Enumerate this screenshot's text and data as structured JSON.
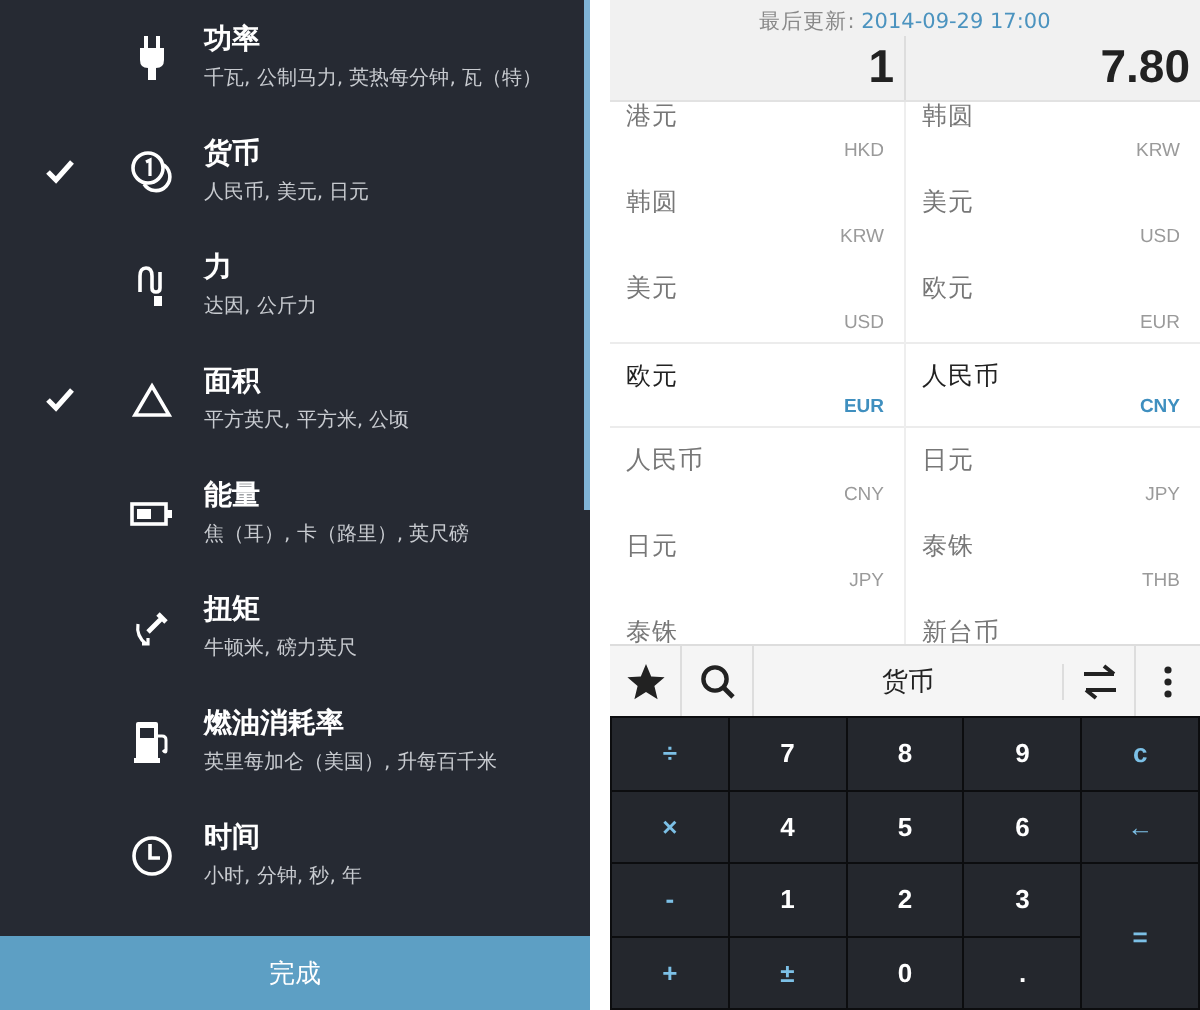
{
  "categories": [
    {
      "title": "功率",
      "subtitle": "千瓦, 公制马力, 英热每分钟, 瓦（特）",
      "checked": false
    },
    {
      "title": "货币",
      "subtitle": "人民币, 美元, 日元",
      "checked": true
    },
    {
      "title": "力",
      "subtitle": "达因, 公斤力",
      "checked": false
    },
    {
      "title": "面积",
      "subtitle": "平方英尺, 平方米, 公顷",
      "checked": true
    },
    {
      "title": "能量",
      "subtitle": "焦（耳）, 卡（路里）, 英尺磅",
      "checked": false
    },
    {
      "title": "扭矩",
      "subtitle": "牛顿米, 磅力英尺",
      "checked": false
    },
    {
      "title": "燃油消耗率",
      "subtitle": "英里每加仑（美国）, 升每百千米",
      "checked": false
    },
    {
      "title": "时间",
      "subtitle": "小时, 分钟, 秒, 年",
      "checked": false
    }
  ],
  "done_button": "完成",
  "converter": {
    "update_label": "最后更新:",
    "update_time": "2014-09-29 17:00",
    "from_value": "1",
    "to_value": "7.80",
    "from_list": [
      {
        "name": "港元",
        "code": "HKD",
        "selected": false
      },
      {
        "name": "韩圆",
        "code": "KRW",
        "selected": false
      },
      {
        "name": "美元",
        "code": "USD",
        "selected": false
      },
      {
        "name": "欧元",
        "code": "EUR",
        "selected": true
      },
      {
        "name": "人民币",
        "code": "CNY",
        "selected": false
      },
      {
        "name": "日元",
        "code": "JPY",
        "selected": false
      },
      {
        "name": "泰铢",
        "selected": false
      }
    ],
    "to_list": [
      {
        "name": "韩圆",
        "code": "KRW",
        "selected": false
      },
      {
        "name": "美元",
        "code": "USD",
        "selected": false
      },
      {
        "name": "欧元",
        "code": "EUR",
        "selected": false
      },
      {
        "name": "人民币",
        "code": "CNY",
        "selected": true
      },
      {
        "name": "日元",
        "code": "JPY",
        "selected": false
      },
      {
        "name": "泰铢",
        "code": "THB",
        "selected": false
      },
      {
        "name": "新台币",
        "selected": false
      }
    ],
    "toolbar_title": "货币",
    "keys": [
      {
        "label": "÷",
        "kind": "op"
      },
      {
        "label": "7",
        "kind": "digit"
      },
      {
        "label": "8",
        "kind": "digit"
      },
      {
        "label": "9",
        "kind": "digit"
      },
      {
        "label": "c",
        "kind": "op"
      },
      {
        "label": "×",
        "kind": "op"
      },
      {
        "label": "4",
        "kind": "digit"
      },
      {
        "label": "5",
        "kind": "digit"
      },
      {
        "label": "6",
        "kind": "digit"
      },
      {
        "label": "←",
        "kind": "op"
      },
      {
        "label": "-",
        "kind": "op"
      },
      {
        "label": "1",
        "kind": "digit"
      },
      {
        "label": "2",
        "kind": "digit"
      },
      {
        "label": "3",
        "kind": "digit"
      },
      {
        "label": "=",
        "kind": "equals"
      },
      {
        "label": "+",
        "kind": "op"
      },
      {
        "label": "±",
        "kind": "op"
      },
      {
        "label": "0",
        "kind": "digit"
      },
      {
        "label": ".",
        "kind": "digit"
      }
    ]
  }
}
